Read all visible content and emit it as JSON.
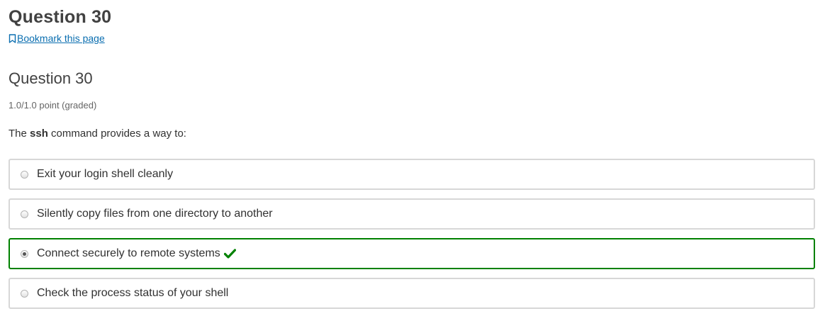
{
  "unit": {
    "title": "Question 30",
    "bookmark_label": "Bookmark this page"
  },
  "problem": {
    "title": "Question 30",
    "points": "1.0/1.0 point (graded)",
    "prompt_prefix": "The ",
    "prompt_bold": "ssh",
    "prompt_suffix": " command provides a way to:",
    "choices": [
      {
        "label": "Exit your login shell cleanly",
        "selected": false,
        "correct": false
      },
      {
        "label": "Silently copy files from one directory to another",
        "selected": false,
        "correct": false
      },
      {
        "label": "Connect securely to remote systems",
        "selected": true,
        "correct": true
      },
      {
        "label": "Check the process status of your shell",
        "selected": false,
        "correct": false
      }
    ]
  },
  "colors": {
    "link": "#0a6eb0",
    "correct": "#008100",
    "border": "#d7d7d7"
  },
  "icons": {
    "bookmark": "bookmark-icon",
    "correct": "checkmark-icon"
  }
}
